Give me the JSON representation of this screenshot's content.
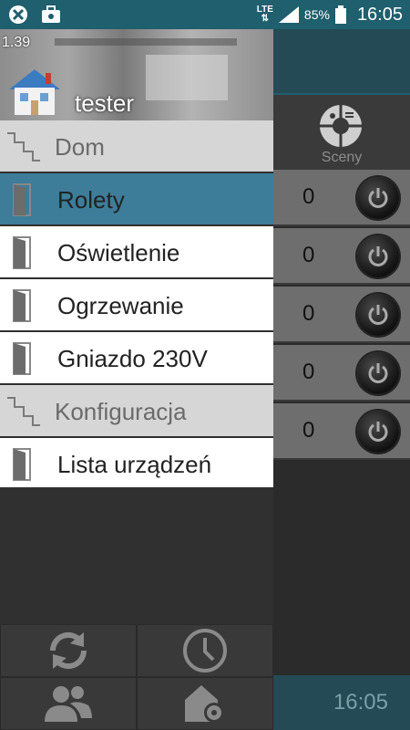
{
  "status_bar": {
    "network": "LTE",
    "battery": "85%",
    "time": "16:05",
    "colors": {
      "background": "#1f5f6e"
    }
  },
  "drawer": {
    "version": "1.39",
    "username": "tester",
    "sections": [
      {
        "label": "Dom"
      },
      {
        "label": "Konfiguracja"
      }
    ],
    "items": [
      {
        "label": "Rolety",
        "selected": true
      },
      {
        "label": "Oświetlenie"
      },
      {
        "label": "Ogrzewanie"
      },
      {
        "label": "Gniazdo 230V"
      },
      {
        "label": "Lista urządzeń"
      }
    ],
    "toolbar_icons": [
      "refresh-icon",
      "clock-icon",
      "users-icon",
      "house-settings-icon"
    ]
  },
  "background_app": {
    "scenes_label": "Sceny",
    "rows": [
      {
        "value": "0"
      },
      {
        "value": "0"
      },
      {
        "value": "0"
      },
      {
        "value": "0"
      },
      {
        "value": "0"
      }
    ],
    "bottom_time": "16:05",
    "accent": "#3d7d99"
  }
}
